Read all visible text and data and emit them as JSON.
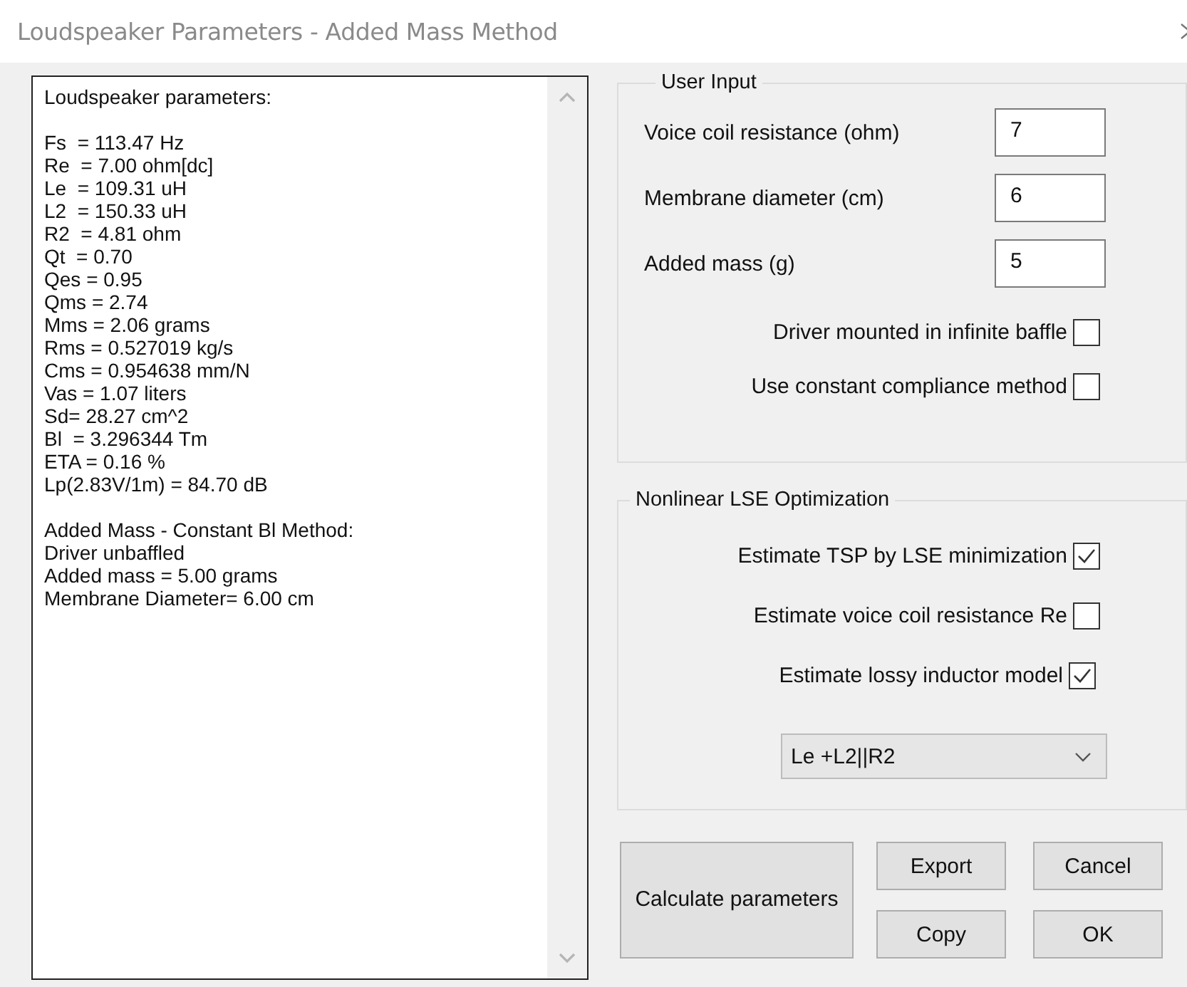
{
  "window": {
    "title": "Loudspeaker Parameters - Added Mass Method"
  },
  "output": {
    "sections": [
      {
        "lines": [
          "Loudspeaker parameters:"
        ]
      },
      {
        "lines": [
          "Fs  = 113.47 Hz",
          "Re  = 7.00 ohm[dc]",
          "Le  = 109.31 uH",
          "L2  = 150.33 uH",
          "R2  = 4.81 ohm",
          "Qt  = 0.70",
          "Qes = 0.95",
          "Qms = 2.74",
          "Mms = 2.06 grams",
          "Rms = 0.527019 kg/s",
          "Cms = 0.954638 mm/N",
          "Vas = 1.07 liters",
          "Sd= 28.27 cm^2",
          "Bl  = 3.296344 Tm",
          "ETA = 0.16 %",
          "Lp(2.83V/1m) = 84.70 dB"
        ]
      },
      {
        "lines": [
          "Added Mass - Constant Bl Method:",
          "Driver unbaffled",
          "Added mass = 5.00 grams",
          "Membrane Diameter= 6.00 cm"
        ]
      }
    ]
  },
  "user_input": {
    "title": "User Input",
    "fields": [
      {
        "label": "Voice coil resistance (ohm)",
        "value": "7"
      },
      {
        "label": "Membrane diameter (cm)",
        "value": "6"
      },
      {
        "label": "Added mass (g)",
        "value": "5"
      }
    ],
    "checkboxes": [
      {
        "label": "Driver mounted in infinite baffle",
        "checked": false
      },
      {
        "label": "Use constant compliance method",
        "checked": false
      }
    ]
  },
  "optimization": {
    "title": "Nonlinear LSE Optimization",
    "checkboxes": [
      {
        "label": "Estimate TSP by LSE minimization",
        "checked": true
      },
      {
        "label": "Estimate voice coil resistance Re",
        "checked": false
      },
      {
        "label": "Estimate lossy inductor model",
        "checked": true
      }
    ],
    "model_dropdown": {
      "value": "Le +L2||R2"
    }
  },
  "buttons": {
    "calculate": "Calculate parameters",
    "export": "Export",
    "cancel": "Cancel",
    "copy": "Copy",
    "ok": "OK"
  }
}
